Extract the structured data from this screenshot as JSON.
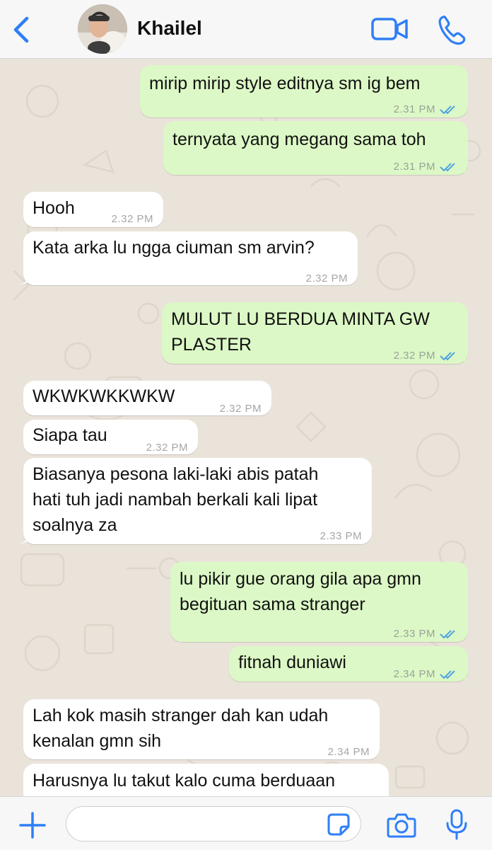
{
  "header": {
    "contact_name": "Khailel",
    "accent": "#2f7ff6"
  },
  "messages": [
    {
      "direction": "out",
      "text": "mirip mirip style editnya sm ig bem",
      "time": "2.31 PM",
      "status": "read"
    },
    {
      "direction": "out",
      "text": "ternyata yang megang sama toh",
      "time": "2.31 PM",
      "status": "read"
    },
    {
      "direction": "in",
      "text": "Hooh",
      "time": "2.32 PM"
    },
    {
      "direction": "in",
      "text": "Kata arka lu ngga ciuman sm arvin?",
      "time": "2.32 PM"
    },
    {
      "direction": "out",
      "text": "MULUT LU BERDUA MINTA GW\nPLASTER",
      "time": "2.32 PM",
      "status": "read"
    },
    {
      "direction": "in",
      "text": "WKWKWKKWKW",
      "time": "2.32 PM"
    },
    {
      "direction": "in",
      "text": "Siapa tau",
      "time": "2.32 PM"
    },
    {
      "direction": "in",
      "text": "Biasanya pesona laki-laki abis patah\nhati tuh jadi nambah berkali kali lipat\nsoalnya za",
      "time": "2.33 PM"
    },
    {
      "direction": "out",
      "text": "lu pikir gue orang gila apa gmn\nbegituan sama stranger",
      "time": "2.33 PM",
      "status": "read"
    },
    {
      "direction": "out",
      "text": "fitnah duniawi",
      "time": "2.34 PM",
      "status": "read"
    },
    {
      "direction": "in",
      "text": "Lah kok masih stranger dah kan udah\nkenalan gmn sih",
      "time": "2.34 PM"
    },
    {
      "direction": "in",
      "text": "Harusnya lu takut kalo cuma berduaan",
      "time": ""
    }
  ],
  "composer": {
    "value": "",
    "placeholder": ""
  },
  "colors": {
    "outgoing_bubble": "#dcf8c6",
    "incoming_bubble": "#ffffff",
    "read_ticks": "#4fa3e0",
    "wallpaper": "#e9e3da"
  }
}
